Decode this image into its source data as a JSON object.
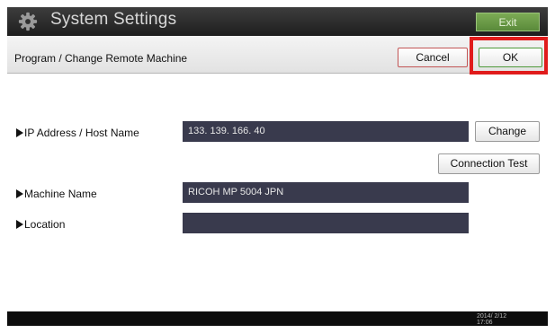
{
  "header": {
    "icon": "gear-icon",
    "title": "System Settings",
    "exit_label": "Exit"
  },
  "subheader": {
    "title": "Program / Change Remote Machine",
    "cancel_label": "Cancel",
    "ok_label": "OK"
  },
  "fields": {
    "ip": {
      "label": "IP Address / Host Name",
      "value": "133. 139. 166. 40",
      "change_label": "Change"
    },
    "connection_test_label": "Connection Test",
    "machine": {
      "label": "Machine Name",
      "value": "RICOH MP 5004 JPN"
    },
    "location": {
      "label": "Location",
      "value": ""
    }
  },
  "status": {
    "date": "2014/ 2/12",
    "time": "17:06"
  },
  "colors": {
    "highlight": "#e01b1b",
    "exit_green": "#6a9b47",
    "field_bg": "#393a4d"
  }
}
